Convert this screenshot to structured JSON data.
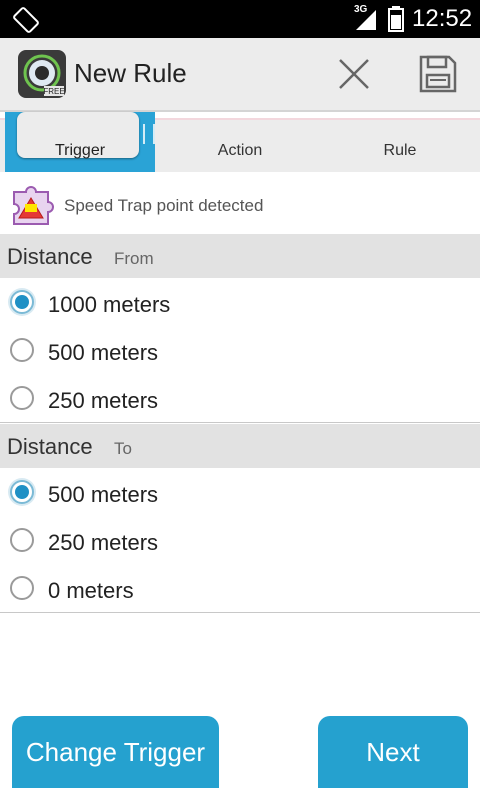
{
  "status_bar": {
    "network": "3G",
    "time": "12:52"
  },
  "action_bar": {
    "title": "New Rule"
  },
  "tabs": [
    {
      "label": "Trigger",
      "active": true
    },
    {
      "label": "Action",
      "active": false
    },
    {
      "label": "Rule",
      "active": false
    }
  ],
  "trigger": {
    "description": "Speed Trap point detected"
  },
  "distance_from": {
    "title": "Distance",
    "subtitle": "From",
    "options": [
      "1000 meters",
      "500 meters",
      "250 meters"
    ],
    "selected": "1000 meters"
  },
  "distance_to": {
    "title": "Distance",
    "subtitle": "To",
    "options": [
      "500 meters",
      "250 meters",
      "0 meters"
    ],
    "selected": "500 meters"
  },
  "buttons": {
    "change_trigger": "Change Trigger",
    "next": "Next"
  },
  "colors": {
    "accent": "#25a1cf",
    "radio_checked": "#1f90c5"
  }
}
